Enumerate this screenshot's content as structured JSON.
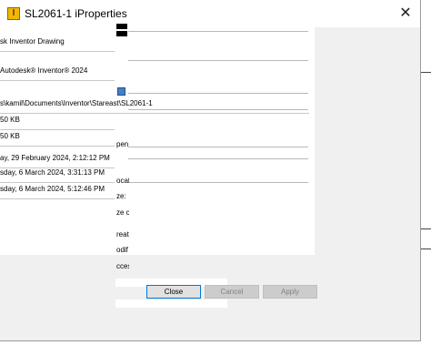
{
  "window": {
    "title": "SL2061-1 iProperties",
    "close_glyph": "✕",
    "icon": "inventor-app-icon"
  },
  "fields": [
    {
      "id": "file-type",
      "text": "sk Inventor Drawing"
    },
    {
      "id": "location-app",
      "text": "Autodesk® Inventor® 2024"
    },
    {
      "id": "location-path",
      "text": "s\\kamil\\Documents\\Inventor\\Stareast\\SL2061-1"
    },
    {
      "id": "size",
      "text": "50 KB"
    },
    {
      "id": "size-on-disk",
      "text": "50 KB"
    },
    {
      "id": "created",
      "text": "ay, 29 February 2024, 2:12:12 PM"
    },
    {
      "id": "modified",
      "text": "sday, 6 March 2024, 3:31:13 PM"
    },
    {
      "id": "accessed",
      "text": "sday, 6 March 2024, 5:12:46 PM"
    }
  ],
  "right_labels": [
    {
      "id": "pen",
      "text": "pen"
    },
    {
      "id": "ocat",
      "text": "ocat"
    },
    {
      "id": "ze",
      "text": "ze:"
    },
    {
      "id": "zec",
      "text": "ze c"
    },
    {
      "id": "reat",
      "text": "reat"
    },
    {
      "id": "odif",
      "text": "odif"
    },
    {
      "id": "cces",
      "text": "cces"
    }
  ],
  "buttons": {
    "close": "Close",
    "cancel": "Cancel",
    "apply": "Apply"
  }
}
